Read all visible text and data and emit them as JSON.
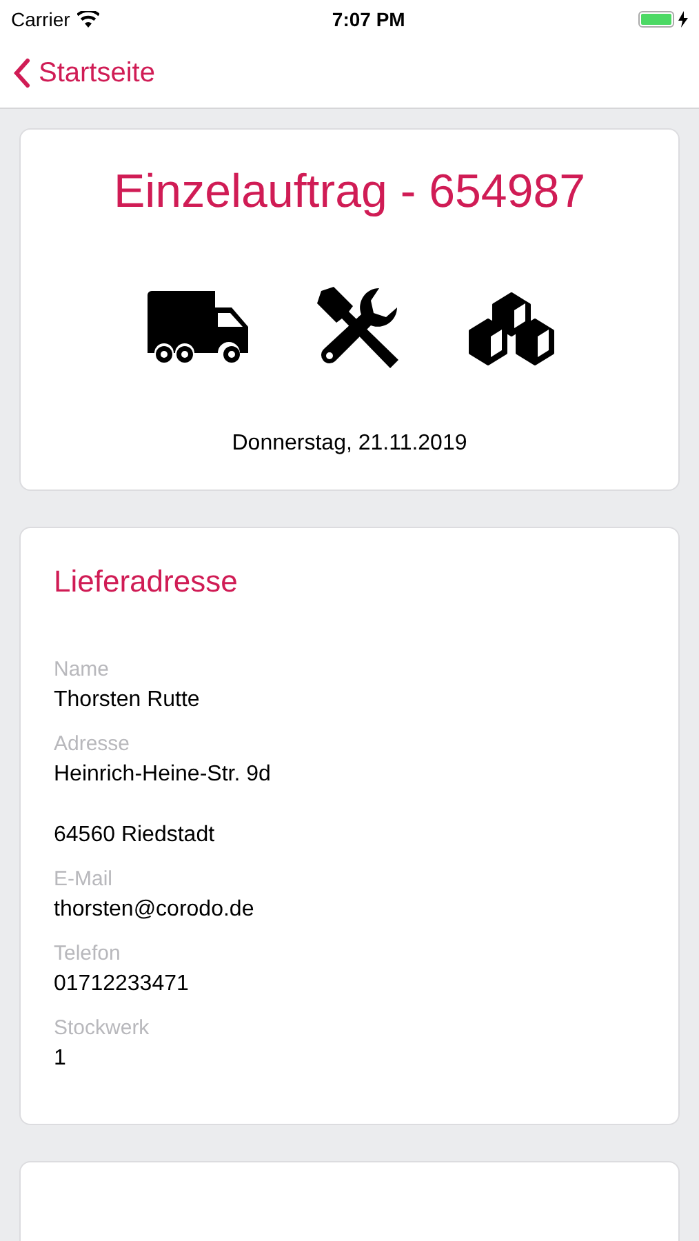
{
  "status_bar": {
    "carrier": "Carrier",
    "time": "7:07 PM"
  },
  "nav": {
    "back_label": "Startseite"
  },
  "order": {
    "title": "Einzelauftrag - 654987",
    "services": [
      {
        "kind": "truck"
      },
      {
        "kind": "tools"
      },
      {
        "kind": "boxes"
      }
    ],
    "date": "Donnerstag, 21.11.2019"
  },
  "delivery_address": {
    "heading": "Lieferadresse",
    "fields": [
      {
        "label": "Name",
        "value": "Thorsten Rutte"
      },
      {
        "label": "Adresse",
        "value": "Heinrich-Heine-Str. 9d\n\n64560 Riedstadt"
      },
      {
        "label": "E-Mail",
        "value": "thorsten@corodo.de"
      },
      {
        "label": "Telefon",
        "value": "01712233471"
      },
      {
        "label": "Stockwerk",
        "value": "1"
      }
    ]
  },
  "next_card": {
    "kind": "card"
  }
}
